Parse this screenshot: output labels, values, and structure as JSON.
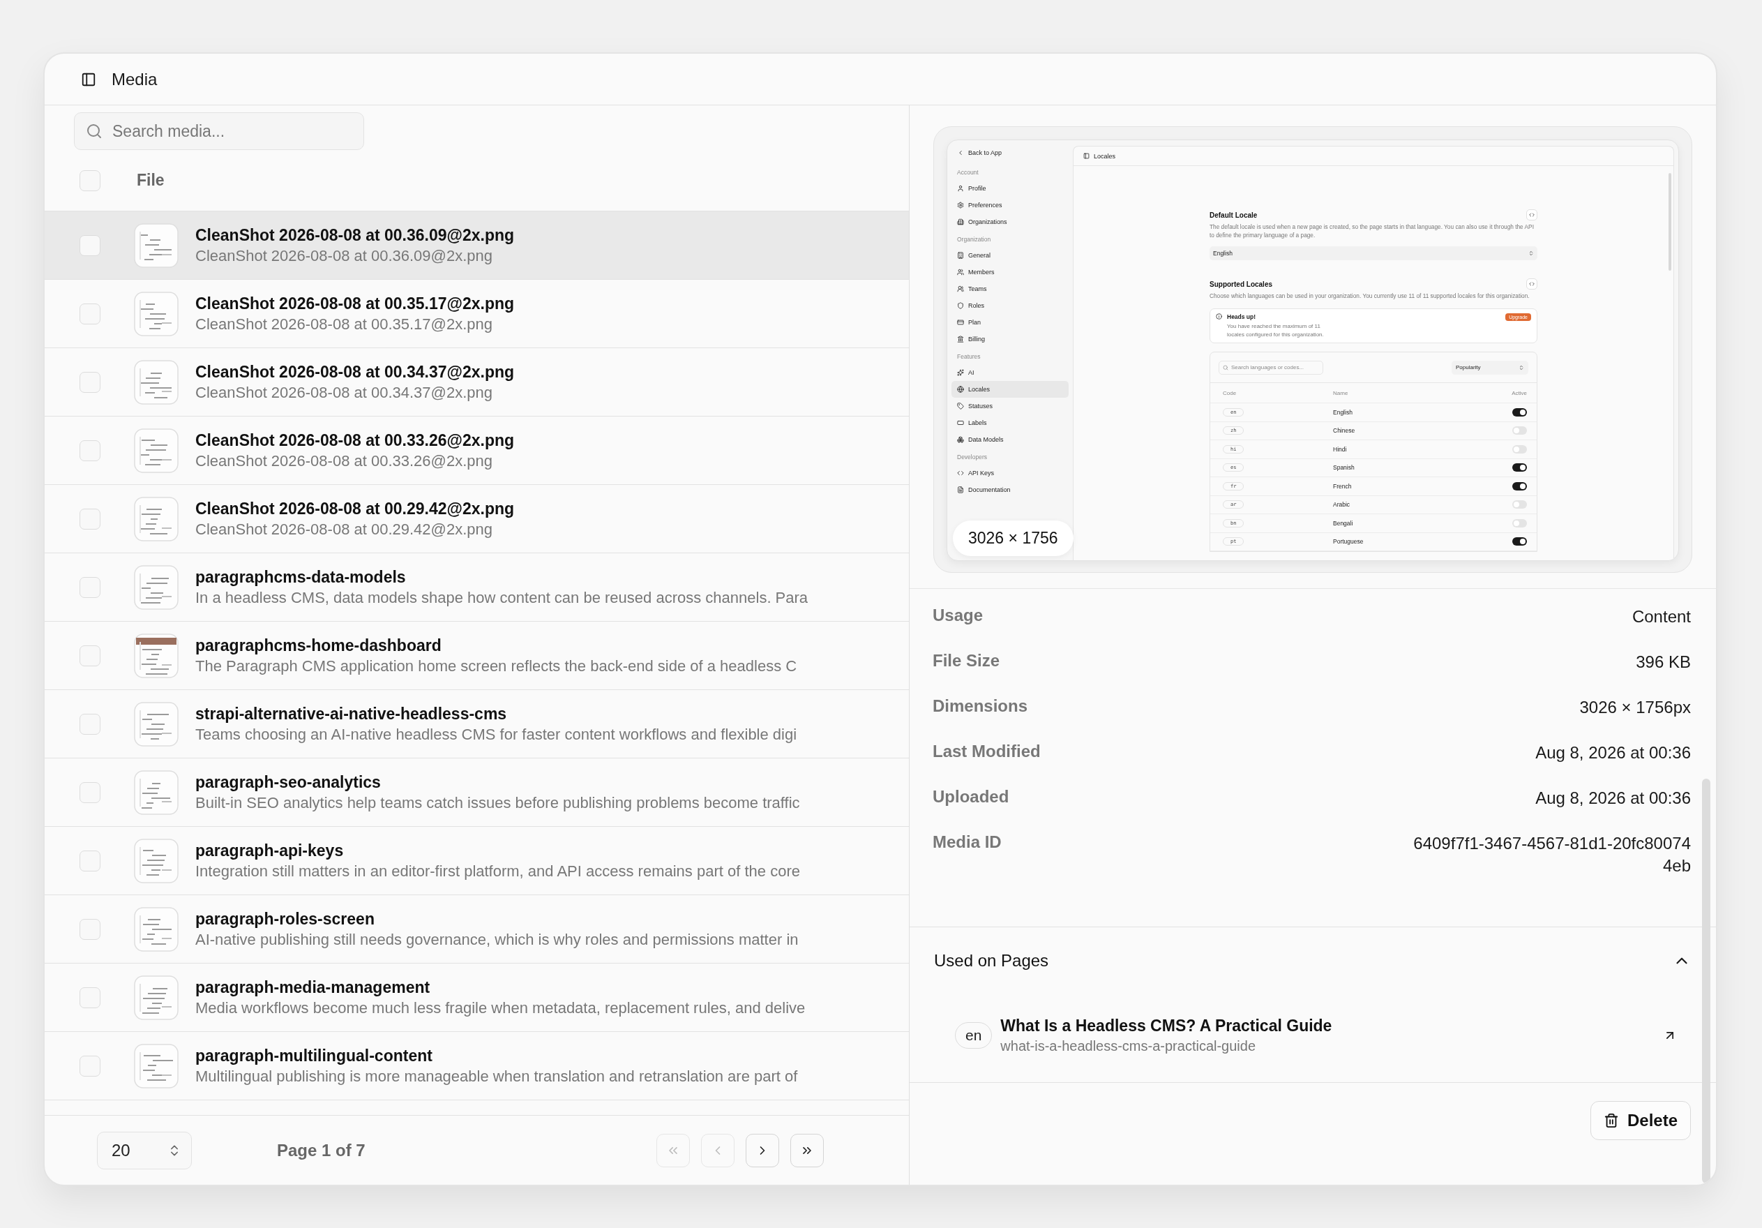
{
  "window": {
    "title": "Media"
  },
  "search": {
    "placeholder": "Search media..."
  },
  "table": {
    "header": {
      "label": "File",
      "checked": false
    },
    "rows": [
      {
        "title": "CleanShot 2026-08-08 at 00.36.09@2x.png",
        "subtitle": "CleanShot 2026-08-08 at 00.36.09@2x.png",
        "selected": true,
        "checked": false
      },
      {
        "title": "CleanShot 2026-08-08 at 00.35.17@2x.png",
        "subtitle": "CleanShot 2026-08-08 at 00.35.17@2x.png",
        "selected": false,
        "checked": false
      },
      {
        "title": "CleanShot 2026-08-08 at 00.34.37@2x.png",
        "subtitle": "CleanShot 2026-08-08 at 00.34.37@2x.png",
        "selected": false,
        "checked": false
      },
      {
        "title": "CleanShot 2026-08-08 at 00.33.26@2x.png",
        "subtitle": "CleanShot 2026-08-08 at 00.33.26@2x.png",
        "selected": false,
        "checked": false
      },
      {
        "title": "CleanShot 2026-08-08 at 00.29.42@2x.png",
        "subtitle": "CleanShot 2026-08-08 at 00.29.42@2x.png",
        "selected": false,
        "checked": false
      },
      {
        "title": "paragraphcms-data-models",
        "subtitle": "In a headless CMS, data models shape how content can be reused across channels. Para",
        "selected": false,
        "checked": false
      },
      {
        "title": "paragraphcms-home-dashboard",
        "subtitle": "The Paragraph CMS application home screen reflects the back-end side of a headless C",
        "selected": false,
        "checked": false
      },
      {
        "title": "strapi-alternative-ai-native-headless-cms",
        "subtitle": "Teams choosing an AI-native headless CMS for faster content workflows and flexible digi",
        "selected": false,
        "checked": false
      },
      {
        "title": "paragraph-seo-analytics",
        "subtitle": "Built-in SEO analytics help teams catch issues before publishing problems become traffic",
        "selected": false,
        "checked": false
      },
      {
        "title": "paragraph-api-keys",
        "subtitle": "Integration still matters in an editor-first platform, and API access remains part of the core",
        "selected": false,
        "checked": false
      },
      {
        "title": "paragraph-roles-screen",
        "subtitle": "AI-native publishing still needs governance, which is why roles and permissions matter in",
        "selected": false,
        "checked": false
      },
      {
        "title": "paragraph-media-management",
        "subtitle": "Media workflows become much less fragile when metadata, replacement rules, and delive",
        "selected": false,
        "checked": false
      },
      {
        "title": "paragraph-multilingual-content",
        "subtitle": "Multilingual publishing is more manageable when translation and retranslation are part of",
        "selected": false,
        "checked": false
      }
    ]
  },
  "pagination": {
    "page_size": "20",
    "page_label": "Page 1 of 7",
    "buttons": [
      {
        "kind": "first",
        "disabled": true
      },
      {
        "kind": "prev",
        "disabled": true
      },
      {
        "kind": "next",
        "disabled": false
      },
      {
        "kind": "last",
        "disabled": false
      }
    ]
  },
  "preview": {
    "dimensions_badge": "3026 × 1756",
    "screenshot": {
      "back_link": "Back to App",
      "nav_groups": [
        {
          "label": "Account",
          "items": [
            {
              "label": "Profile",
              "selected": false
            },
            {
              "label": "Preferences",
              "selected": false
            },
            {
              "label": "Organizations",
              "selected": false
            }
          ]
        },
        {
          "label": "Organization",
          "items": [
            {
              "label": "General",
              "selected": false
            },
            {
              "label": "Members",
              "selected": false
            },
            {
              "label": "Teams",
              "selected": false
            },
            {
              "label": "Roles",
              "selected": false
            },
            {
              "label": "Plan",
              "selected": false
            },
            {
              "label": "Billing",
              "selected": false
            }
          ]
        },
        {
          "label": "Features",
          "items": [
            {
              "label": "AI",
              "selected": false
            },
            {
              "label": "Locales",
              "selected": true
            },
            {
              "label": "Statuses",
              "selected": false
            },
            {
              "label": "Labels",
              "selected": false
            },
            {
              "label": "Data Models",
              "selected": false
            }
          ]
        },
        {
          "label": "Developers",
          "items": [
            {
              "label": "API Keys",
              "selected": false
            },
            {
              "label": "Documentation",
              "selected": false
            }
          ]
        }
      ],
      "header_title": "Locales",
      "default_locale": {
        "title": "Default Locale",
        "description": "The default locale is used when a new page is created, so the page starts in that language. You can also use it through the API to define the primary language of a page.",
        "value": "English"
      },
      "supported_locales": {
        "title": "Supported Locales",
        "description": "Choose which languages can be used in your organization. You currently use 11 of 11 supported locales for this organization."
      },
      "alert": {
        "title": "Heads up!",
        "message": "You have reached the maximum of 11 locales configured for this organization.",
        "badge": "Upgrade"
      },
      "locale_search": {
        "placeholder": "Search languages or codes..."
      },
      "sort_value": "Popularity",
      "columns": [
        "Code",
        "Name",
        "Active"
      ],
      "locales": [
        {
          "code": "en",
          "name": "English",
          "on": true
        },
        {
          "code": "zh",
          "name": "Chinese",
          "on": false
        },
        {
          "code": "hi",
          "name": "Hindi",
          "on": false
        },
        {
          "code": "es",
          "name": "Spanish",
          "on": true
        },
        {
          "code": "fr",
          "name": "French",
          "on": true
        },
        {
          "code": "ar",
          "name": "Arabic",
          "on": false
        },
        {
          "code": "bn",
          "name": "Bengali",
          "on": false
        },
        {
          "code": "pt",
          "name": "Portuguese",
          "on": true
        }
      ]
    }
  },
  "details": [
    {
      "label": "Usage",
      "value": "Content"
    },
    {
      "label": "File Size",
      "value": "396 KB"
    },
    {
      "label": "Dimensions",
      "value": "3026 × 1756px"
    },
    {
      "label": "Last Modified",
      "value": "Aug 8, 2026 at 00:36"
    },
    {
      "label": "Uploaded",
      "value": "Aug 8, 2026 at 00:36"
    },
    {
      "label": "Media ID",
      "value": "6409f7f1-3467-4567-81d1-20fc800744eb"
    }
  ],
  "used_on_pages": {
    "title": "Used on Pages",
    "expanded": true,
    "pages": [
      {
        "locale": "en",
        "title": "What Is a Headless CMS? A Practical Guide",
        "slug": "what-is-a-headless-cms-a-practical-guide"
      }
    ]
  },
  "delete_button": "Delete"
}
